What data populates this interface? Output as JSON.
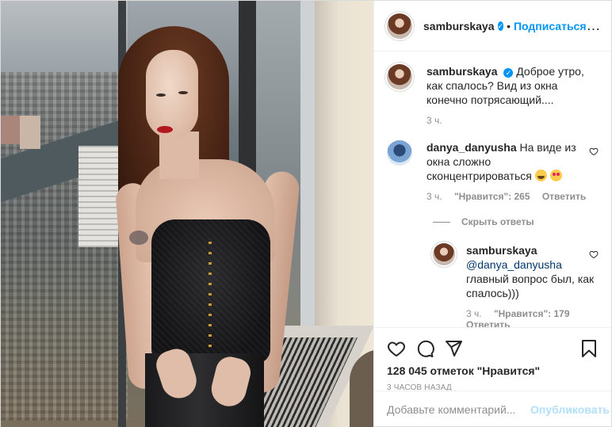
{
  "header": {
    "username": "samburskaya",
    "verified_icon": "verified-badge-icon",
    "separator": "•",
    "follow_label": "Подписаться",
    "more_icon": "…"
  },
  "caption": {
    "username": "samburskaya",
    "text": "Доброе утро, как спалось? Вид из окна конечно потрясающий....",
    "time": "3 ч."
  },
  "comments": [
    {
      "username": "danya_danyusha",
      "text": "На виде из окна сложно сконцентрироваться",
      "emoji": [
        "face-with-tears-of-joy",
        "smiling-face-with-heart-eyes"
      ],
      "time": "3 ч.",
      "likes": "\"Нравится\": 265",
      "reply_label": "Ответить"
    }
  ],
  "hide_replies_label": "Скрыть ответы",
  "reply": {
    "username": "samburskaya",
    "mention": "@danya_danyusha",
    "text": "главный вопрос был, как спалось)))",
    "time": "3 ч.",
    "likes": "\"Нравится\": 179",
    "reply_label": "Ответить"
  },
  "actions": {
    "like_icon": "heart-icon",
    "comment_icon": "comment-icon",
    "share_icon": "share-icon",
    "save_icon": "bookmark-icon",
    "likes_text": "128 045 отметок \"Нравится\"",
    "posted": "3 часов назад"
  },
  "add_comment": {
    "placeholder": "Добавьте комментарий...",
    "publish_label": "Опубликовать"
  },
  "colors": {
    "accent": "#0095f6",
    "publish_disabled": "#b2dffc",
    "muted": "#8e8e8e",
    "text": "#262626"
  }
}
